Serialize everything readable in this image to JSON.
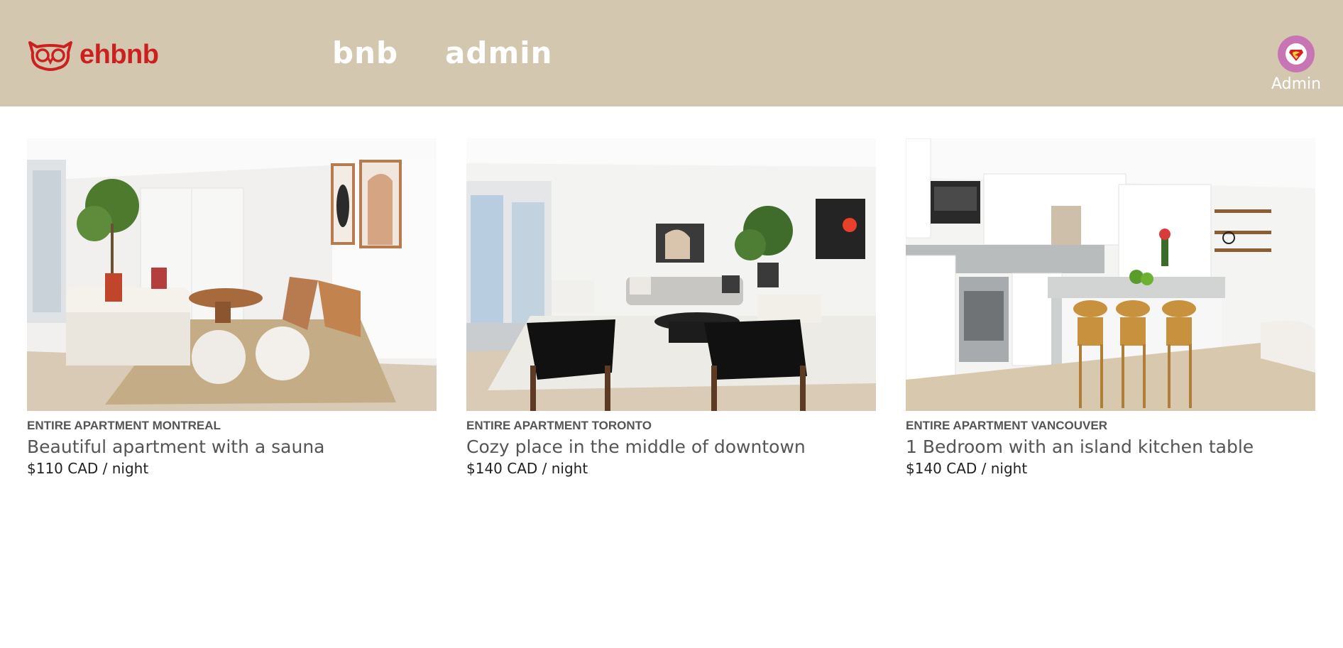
{
  "header": {
    "logo_text": "ehbnb",
    "logo_icon": "owl-logo-icon",
    "nav": [
      "bnb",
      "admin"
    ],
    "user": {
      "label": "Admin",
      "avatar_icon": "superhero-avatar-icon"
    }
  },
  "colors": {
    "header_bg": "#d4c7b0",
    "brand_red": "#cc1f1f",
    "avatar_bg": "#c875b3"
  },
  "listings": [
    {
      "type": "ENTIRE APARTMENT MONTREAL",
      "title": "Beautiful apartment with a sauna",
      "price": "$110 CAD / night",
      "photo": "living-room-photo"
    },
    {
      "type": "ENTIRE APARTMENT TORONTO",
      "title": "Cozy place in the middle of downtown",
      "price": "$140 CAD / night",
      "photo": "lounge-photo"
    },
    {
      "type": "ENTIRE APARTMENT VANCOUVER",
      "title": "1 Bedroom with an island kitchen table",
      "price": "$140 CAD / night",
      "photo": "kitchen-photo"
    }
  ]
}
